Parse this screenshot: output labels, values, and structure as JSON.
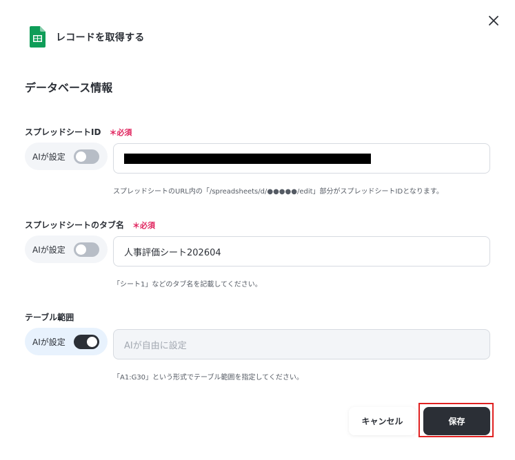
{
  "header": {
    "app_icon": "google-sheets-icon",
    "title": "レコードを取得する"
  },
  "close_icon": "close-icon",
  "section_title": "データベース情報",
  "fields": [
    {
      "label": "スプレッドシートID",
      "required": "＊必須",
      "ai_label": "AIが設定",
      "ai_enabled": false,
      "value": "",
      "value_redacted": true,
      "placeholder": "",
      "help": "スプレッドシートのURL内の「/spreadsheets/d/●●●●●/edit」部分がスプレッドシートIDとなります。"
    },
    {
      "label": "スプレッドシートのタブ名",
      "required": "＊必須",
      "ai_label": "AIが設定",
      "ai_enabled": false,
      "value": "人事評価シート202604",
      "placeholder": "",
      "help": "「シート1」などのタブ名を記載してください。"
    },
    {
      "label": "テーブル範囲",
      "required": "",
      "ai_label": "AIが設定",
      "ai_enabled": true,
      "value": "",
      "placeholder": "AIが自由に設定",
      "help": "「A1:G30」という形式でテーブル範囲を指定してください。"
    }
  ],
  "footer": {
    "cancel_label": "キャンセル",
    "save_label": "保存"
  },
  "colors": {
    "primary_dark": "#2b2f36",
    "required_red": "#e0245e",
    "highlight_red": "#e02020",
    "sheets_green": "#0f9d58"
  }
}
